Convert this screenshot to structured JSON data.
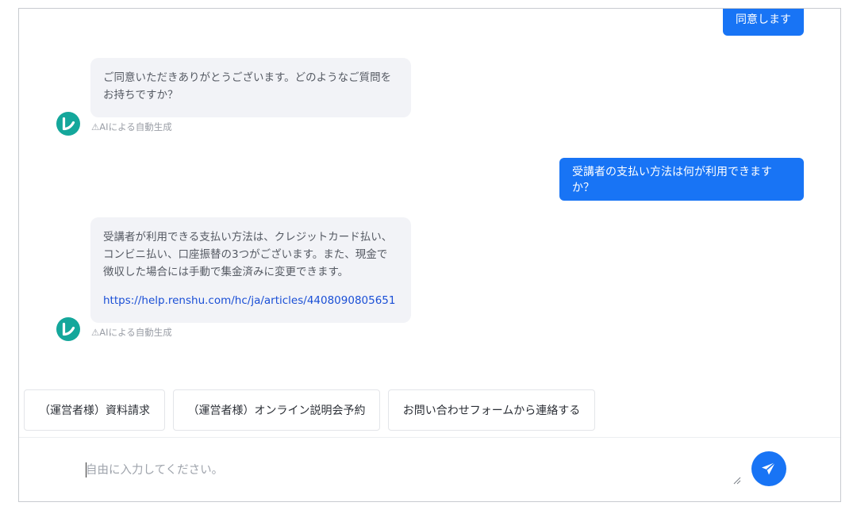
{
  "messages": [
    {
      "role": "user",
      "text": "同意します"
    },
    {
      "role": "bot",
      "lines": [
        "ご同意いただきありがとうございます。どのようなご質問を",
        "お持ちですか？"
      ],
      "note": "⚠AIによる自動生成"
    },
    {
      "role": "user",
      "text": "受講者の支払い方法は何が利用できますか？"
    },
    {
      "role": "bot",
      "lines": [
        "受講者が利用できる支払い方法は、クレジットカード払い、",
        "コンビニ払い、口座振替の3つがございます。また、現金で",
        "徴収した場合には手動で集金済みに変更できます。"
      ],
      "link": "https://help.renshu.com/hc/ja/articles/4408090805651",
      "note": "⚠AIによる自動生成"
    }
  ],
  "quick_replies": [
    "（運営者様）資料請求",
    "（運営者様）オンライン説明会予約",
    "お問い合わせフォームから連絡する"
  ],
  "composer": {
    "placeholder": "自由に入力してください。",
    "send_icon": "paper-plane-icon"
  },
  "avatar_icon": "bot-logo-icon",
  "colors": {
    "accent": "#1874f5",
    "avatar": "#14a79b",
    "bot_bubble": "#f2f3f7",
    "link": "#1a4fd6"
  }
}
